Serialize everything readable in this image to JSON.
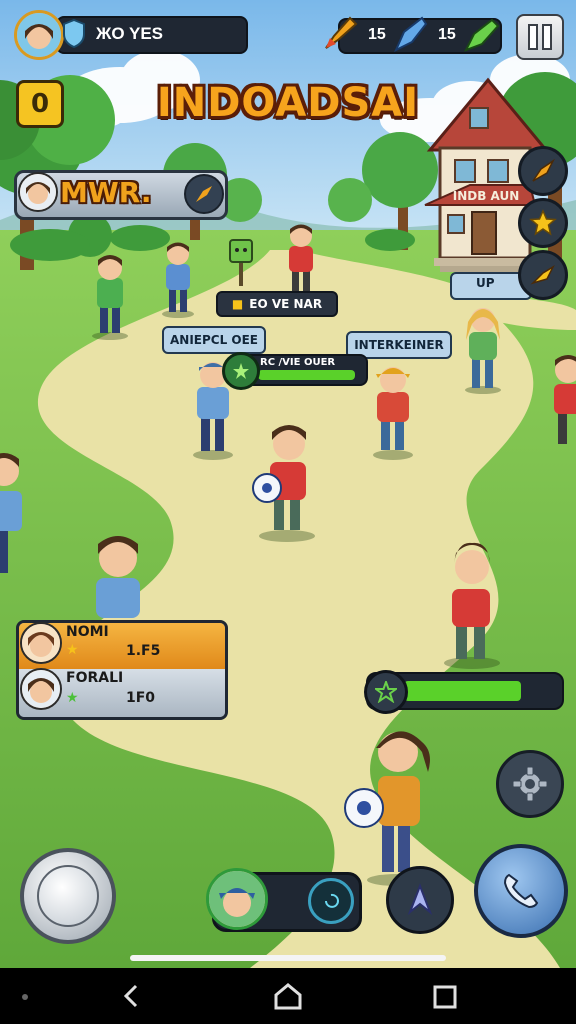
{
  "hud": {
    "profile_name": "ЖO YES",
    "item1_count": "15",
    "item2_count": "15"
  },
  "title": "INDOADSAI",
  "left_badge": "0",
  "team_banner": "MWR.",
  "building_sign": "INDB AUN",
  "sign_up": "UP",
  "labels": {
    "center_top": "EO VE NAR",
    "left_mid": "ANIEPCL OEE",
    "right_mid": "INTERKEINER",
    "progress_label": "RC /VIE OUER"
  },
  "progress": {
    "main": 0.95,
    "right": 0.8
  },
  "scoreboard": [
    {
      "name": "NOMI",
      "value": "1.F5"
    },
    {
      "name": "FORALI",
      "value": "1F0"
    }
  ],
  "icons": {
    "shield": "shield-icon",
    "pause": "pause-icon",
    "settings": "gear-icon",
    "call": "phone-icon",
    "boost": "boost-icon"
  },
  "colors": {
    "accent": "#f0a21d",
    "progress_fill": "#5ad12a",
    "hud_dark": "#1f2733",
    "sky": "#8ec6ef"
  }
}
